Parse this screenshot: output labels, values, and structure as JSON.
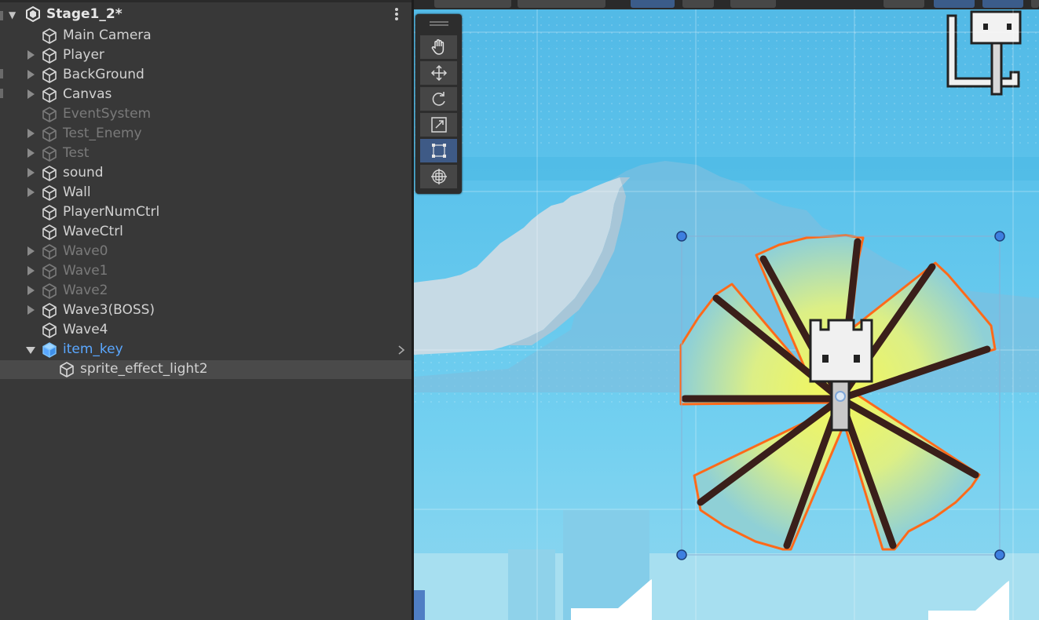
{
  "hierarchy": {
    "scene_name": "Stage1_2*",
    "items": [
      {
        "label": "Main Camera",
        "expandable": false,
        "active": true
      },
      {
        "label": "Player",
        "expandable": true,
        "active": true
      },
      {
        "label": "BackGround",
        "expandable": true,
        "active": true
      },
      {
        "label": "Canvas",
        "expandable": true,
        "active": true
      },
      {
        "label": "EventSystem",
        "expandable": false,
        "active": false
      },
      {
        "label": "Test_Enemy",
        "expandable": true,
        "active": false
      },
      {
        "label": "Test",
        "expandable": true,
        "active": false
      },
      {
        "label": "sound",
        "expandable": true,
        "active": true
      },
      {
        "label": "Wall",
        "expandable": true,
        "active": true
      },
      {
        "label": "PlayerNumCtrl",
        "expandable": false,
        "active": true
      },
      {
        "label": "WaveCtrl",
        "expandable": false,
        "active": true
      },
      {
        "label": "Wave0",
        "expandable": true,
        "active": false
      },
      {
        "label": "Wave1",
        "expandable": true,
        "active": false
      },
      {
        "label": "Wave2",
        "expandable": true,
        "active": false
      },
      {
        "label": "Wave3(BOSS)",
        "expandable": true,
        "active": true
      },
      {
        "label": "Wave4",
        "expandable": false,
        "active": true
      },
      {
        "label": "item_key",
        "expandable": true,
        "expanded": true,
        "active": true,
        "selected_parent": true
      },
      {
        "label": "sprite_effect_light2",
        "expandable": false,
        "active": true,
        "child": true,
        "selected": true
      }
    ]
  },
  "scene_tools": [
    {
      "name": "hand-tool",
      "icon": "hand-icon",
      "active": false
    },
    {
      "name": "move-tool",
      "icon": "move-icon",
      "active": false
    },
    {
      "name": "rotate-tool",
      "icon": "rotate-icon",
      "active": false
    },
    {
      "name": "scale-tool",
      "icon": "scale-icon",
      "active": false
    },
    {
      "name": "rect-tool",
      "icon": "rect-icon",
      "active": true
    },
    {
      "name": "transform-tool",
      "icon": "transform-icon",
      "active": false
    }
  ],
  "colors": {
    "panel_bg": "#383838",
    "text": "#d2d2d2",
    "inactive_text": "#7a7a7a",
    "selected_text": "#5aa7ff",
    "sky": "#5fc3ea",
    "sprite_outline": "#ff6a1a",
    "ray_center": "#f2f55a"
  }
}
